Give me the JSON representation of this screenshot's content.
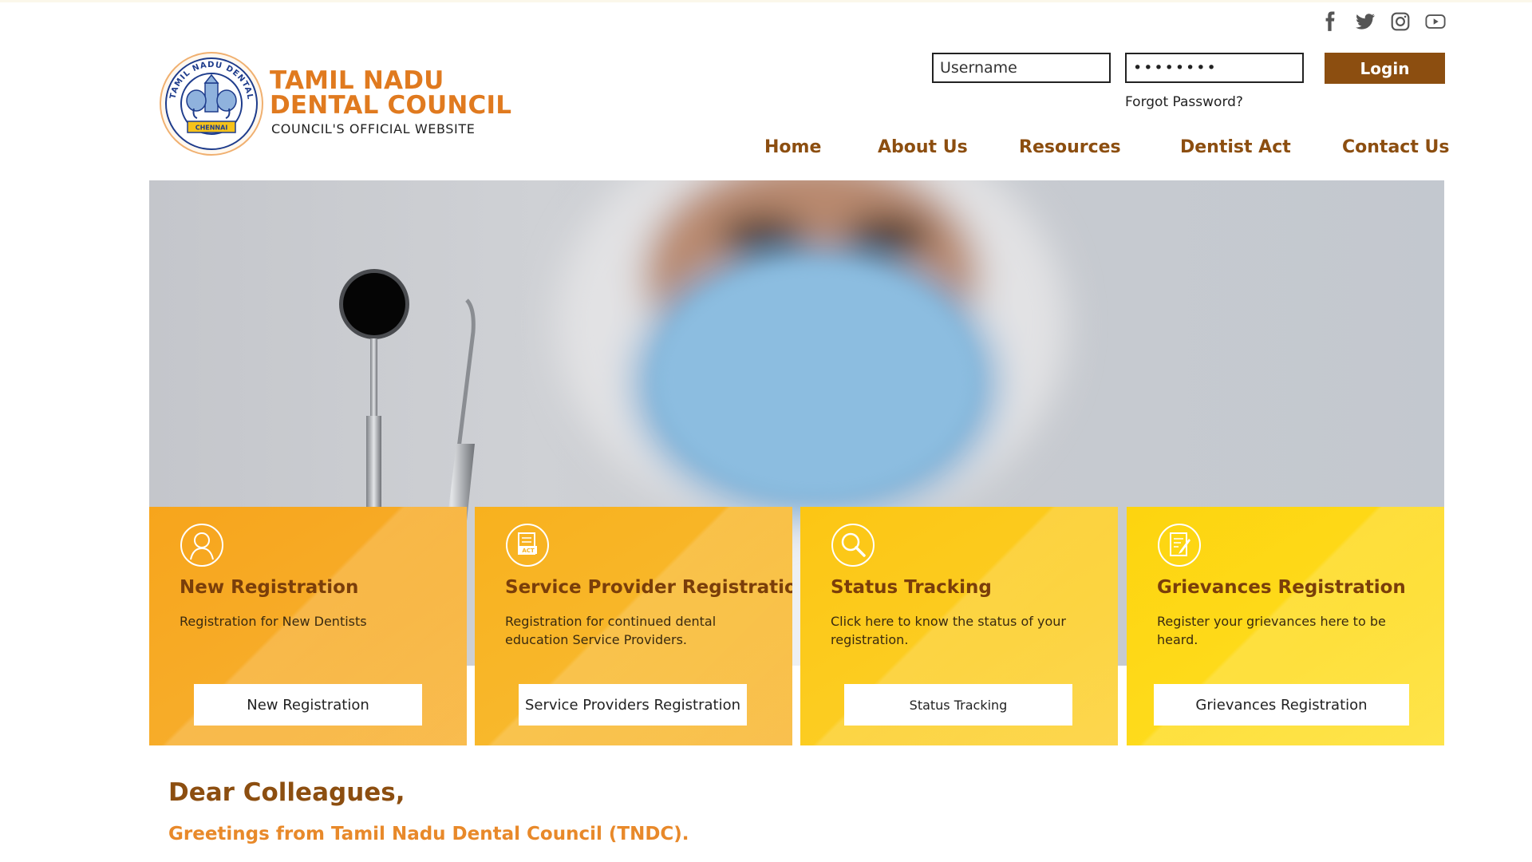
{
  "social": {
    "icons": [
      "facebook-icon",
      "twitter-icon",
      "instagram-icon",
      "youtube-icon"
    ]
  },
  "brand": {
    "title_line1": "TAMIL NADU",
    "title_line2": "DENTAL COUNCIL",
    "subtitle": "COUNCIL'S OFFICIAL WEBSITE",
    "emblem_text": "TAMIL NADU DENTAL COUNCIL",
    "emblem_city": "CHENNAI",
    "accent_color": "#e07a1f",
    "brown_color": "#8c4e10"
  },
  "login": {
    "username_placeholder": "Username",
    "password_value": "••••••••",
    "login_label": "Login",
    "forgot_label": "Forgot Password?"
  },
  "nav": {
    "items": [
      "Home",
      "About Us",
      "Resources",
      "Dentist Act",
      "Contact Us"
    ]
  },
  "cards": [
    {
      "icon": "user-icon",
      "title": "New Registration",
      "description": "Registration for New Dentists",
      "button": "New Registration"
    },
    {
      "icon": "act-document-icon",
      "title": "Service Provider Registration",
      "description": "Registration for continued dental education Service Providers.",
      "button": "Service Providers Registration"
    },
    {
      "icon": "search-icon",
      "title": "Status Tracking",
      "description": "Click here to know the status of your registration.",
      "button": "Status Tracking"
    },
    {
      "icon": "edit-document-icon",
      "title": "Grievances Registration",
      "description": "Register your grievances here to be heard.",
      "button": "Grievances Registration"
    }
  ],
  "welcome": {
    "heading": "Dear Colleagues,",
    "greeting": "Greetings from Tamil Nadu Dental Council (TNDC)."
  }
}
